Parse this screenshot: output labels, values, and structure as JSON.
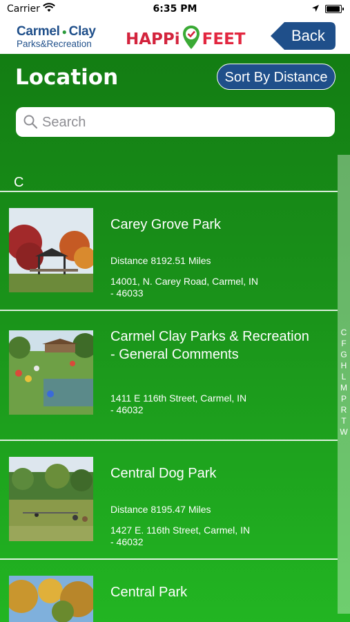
{
  "status_bar": {
    "carrier": "Carrier",
    "time": "6:35 PM"
  },
  "header": {
    "carmel_line1": "Carmel",
    "carmel_line1b": "Clay",
    "carmel_line2": "Parks&Recreation",
    "happi_left": "HAPPi",
    "happi_right": "FEET",
    "back_label": "Back"
  },
  "page": {
    "title": "Location",
    "sort_label": "Sort By Distance",
    "search_placeholder": "Search",
    "section_letter": "C"
  },
  "locations": [
    {
      "name": "Carey Grove Park",
      "distance": "Distance 8192.51 Miles",
      "address_line1": "14001, N. Carey Road, Carmel, IN",
      "address_line2": "- 46033"
    },
    {
      "name_line1": "Carmel Clay Parks & Recreation",
      "name_line2": "- General Comments",
      "distance": "",
      "address_line1": "1411 E 116th Street, Carmel, IN",
      "address_line2": "- 46032"
    },
    {
      "name": "Central Dog Park",
      "distance": "Distance 8195.47 Miles",
      "address_line1": "1427 E. 116th Street, Carmel, IN",
      "address_line2": "- 46032"
    },
    {
      "name": "Central Park"
    }
  ],
  "index_letters": [
    "C",
    "F",
    "G",
    "H",
    "L",
    "M",
    "P",
    "R",
    "T",
    "W"
  ]
}
